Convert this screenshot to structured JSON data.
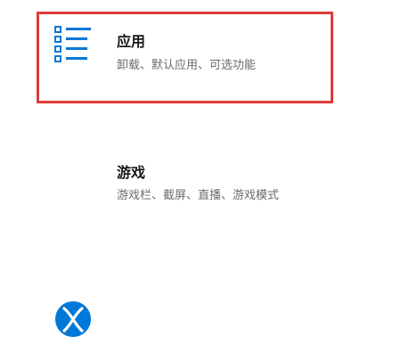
{
  "tiles": {
    "apps": {
      "title": "应用",
      "subtitle": "卸载、默认应用、可选功能",
      "icon": "apps-list-icon"
    },
    "games": {
      "title": "游戏",
      "subtitle": "游戏栏、截屏、直播、游戏模式",
      "icon": "xbox-icon"
    }
  },
  "colors": {
    "accent": "#0078d7",
    "highlight": "#e03c3c",
    "title": "#1a1a1a",
    "subtitle": "#6b6b6b"
  }
}
